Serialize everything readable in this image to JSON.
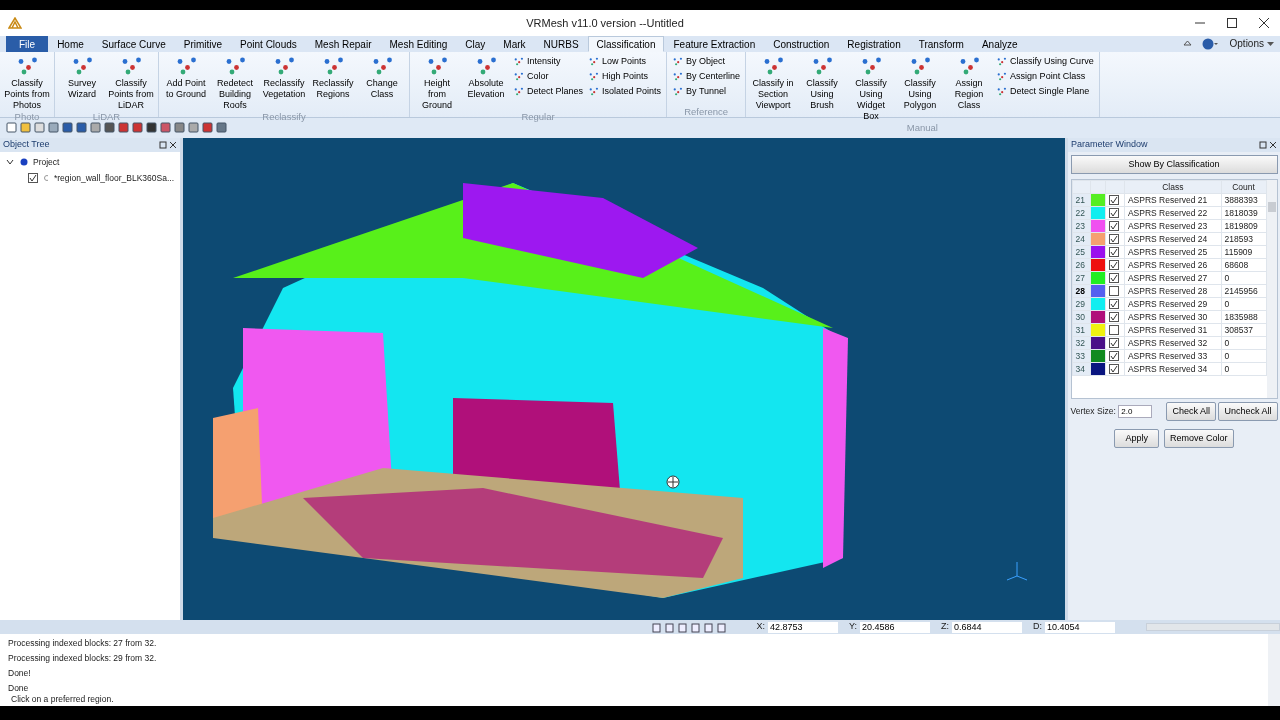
{
  "window": {
    "title": "VRMesh v11.0 version --Untitled"
  },
  "tabs": [
    {
      "label": "File",
      "selected": false,
      "kind": "file"
    },
    {
      "label": "Home",
      "selected": false
    },
    {
      "label": "Surface Curve",
      "selected": false
    },
    {
      "label": "Primitive",
      "selected": false
    },
    {
      "label": "Point Clouds",
      "selected": false
    },
    {
      "label": "Mesh Repair",
      "selected": false
    },
    {
      "label": "Mesh Editing",
      "selected": false
    },
    {
      "label": "Clay",
      "selected": false
    },
    {
      "label": "Mark",
      "selected": false
    },
    {
      "label": "NURBS",
      "selected": false
    },
    {
      "label": "Classification",
      "selected": true
    },
    {
      "label": "Feature Extraction",
      "selected": false
    },
    {
      "label": "Construction",
      "selected": false
    },
    {
      "label": "Registration",
      "selected": false
    },
    {
      "label": "Transform",
      "selected": false
    },
    {
      "label": "Analyze",
      "selected": false
    }
  ],
  "options_menu": {
    "label": "Options"
  },
  "ribbon_groups": [
    {
      "title": "Photo",
      "items": [
        {
          "kind": "large",
          "label": "Classify Points from Photos"
        }
      ]
    },
    {
      "title": "LiDAR",
      "items": [
        {
          "kind": "large",
          "label": "Survey Wizard"
        },
        {
          "kind": "large",
          "label": "Classify Points from LiDAR"
        }
      ]
    },
    {
      "title": "Reclassify",
      "items": [
        {
          "kind": "large",
          "label": "Add Point to Ground"
        },
        {
          "kind": "large",
          "label": "Redetect Building Roofs"
        },
        {
          "kind": "large",
          "label": "Reclassify Vegetation"
        },
        {
          "kind": "large",
          "label": "Reclassify Regions"
        },
        {
          "kind": "large",
          "label": "Change Class"
        }
      ]
    },
    {
      "title": "Regular",
      "items": [
        {
          "kind": "large",
          "label": "Height from Ground"
        },
        {
          "kind": "large",
          "label": "Absolute Elevation"
        },
        {
          "kind": "small",
          "label": "Intensity"
        },
        {
          "kind": "small",
          "label": "Color"
        },
        {
          "kind": "small",
          "label": "Detect Planes"
        },
        {
          "kind": "small",
          "label": "Low Points"
        },
        {
          "kind": "small",
          "label": "High Points"
        },
        {
          "kind": "small",
          "label": "Isolated Points"
        }
      ]
    },
    {
      "title": "Reference",
      "items": [
        {
          "kind": "small",
          "label": "By Object"
        },
        {
          "kind": "small",
          "label": "By Centerline"
        },
        {
          "kind": "small",
          "label": "By Tunnel"
        }
      ]
    },
    {
      "title": "Manual",
      "items": [
        {
          "kind": "large",
          "label": "Classify in Section Viewport"
        },
        {
          "kind": "large",
          "label": "Classify Using Brush"
        },
        {
          "kind": "large",
          "label": "Classify Using Widget Box"
        },
        {
          "kind": "large",
          "label": "Classify Using Polygon"
        },
        {
          "kind": "large",
          "label": "Assign Region Class"
        },
        {
          "kind": "small",
          "label": "Classify Using Curve"
        },
        {
          "kind": "small",
          "label": "Assign Point Class"
        },
        {
          "kind": "small",
          "label": "Detect Single Plane"
        }
      ]
    }
  ],
  "object_tree": {
    "title": "Object Tree",
    "items": [
      {
        "label": "Project",
        "expanded": true,
        "children": [
          {
            "label": "*region_wall_floor_BLK360Sa...",
            "checked": true
          }
        ]
      }
    ]
  },
  "parameter_window": {
    "title": "Parameter Window",
    "mode_button": "Show By Classification",
    "columns": [
      "Class",
      "Count"
    ],
    "rows": [
      {
        "number": "21",
        "color": "#55ee22",
        "checked": true,
        "class": "ASPRS Reserved 21",
        "count": "3888393",
        "selected": false
      },
      {
        "number": "22",
        "color": "#11eef0",
        "checked": true,
        "class": "ASPRS Reserved 22",
        "count": "1818039",
        "selected": false
      },
      {
        "number": "23",
        "color": "#f050f0",
        "checked": true,
        "class": "ASPRS Reserved 23",
        "count": "1819809",
        "selected": false
      },
      {
        "number": "24",
        "color": "#f5a070",
        "checked": true,
        "class": "ASPRS Reserved 24",
        "count": "218593",
        "selected": false
      },
      {
        "number": "25",
        "color": "#9a10ee",
        "checked": true,
        "class": "ASPRS Reserved 25",
        "count": "115909",
        "selected": false
      },
      {
        "number": "26",
        "color": "#ee1010",
        "checked": true,
        "class": "ASPRS Reserved 26",
        "count": "68608",
        "selected": false
      },
      {
        "number": "27",
        "color": "#22ee22",
        "checked": true,
        "class": "ASPRS Reserved 27",
        "count": "0",
        "selected": false
      },
      {
        "number": "28",
        "color": "#5560f0",
        "checked": false,
        "class": "ASPRS Reserved 28",
        "count": "2145956",
        "selected": true
      },
      {
        "number": "29",
        "color": "#11eef0",
        "checked": true,
        "class": "ASPRS Reserved 29",
        "count": "0",
        "selected": false
      },
      {
        "number": "30",
        "color": "#b0107a",
        "checked": true,
        "class": "ASPRS Reserved 30",
        "count": "1835988",
        "selected": false
      },
      {
        "number": "31",
        "color": "#f0f010",
        "checked": false,
        "class": "ASPRS Reserved 31",
        "count": "308537",
        "selected": false
      },
      {
        "number": "32",
        "color": "#4a1088",
        "checked": true,
        "class": "ASPRS Reserved 32",
        "count": "0",
        "selected": false
      },
      {
        "number": "33",
        "color": "#108a20",
        "checked": true,
        "class": "ASPRS Reserved 33",
        "count": "0",
        "selected": false
      },
      {
        "number": "34",
        "color": "#0a1580",
        "checked": true,
        "class": "ASPRS Reserved 34",
        "count": "0",
        "selected": false
      }
    ],
    "vertex_size": {
      "label": "Vertex Size:",
      "value": "2.0"
    },
    "buttons": [
      "Check All",
      "Uncheck All",
      "Apply",
      "Remove Color"
    ]
  },
  "status_bar": {
    "progress": {
      "level": 0
    },
    "coords": [
      {
        "label": "X:",
        "value": "42.8753"
      },
      {
        "label": "Y:",
        "value": "20.4586"
      },
      {
        "label": "Z:",
        "value": "0.6844"
      },
      {
        "label": "D:",
        "value": "10.4054"
      }
    ]
  },
  "log": [
    "Processing indexed blocks: 27 from 32.",
    "Processing indexed blocks: 29 from 32.",
    "Done!",
    "Done"
  ],
  "prompt": "Click on a preferred region."
}
